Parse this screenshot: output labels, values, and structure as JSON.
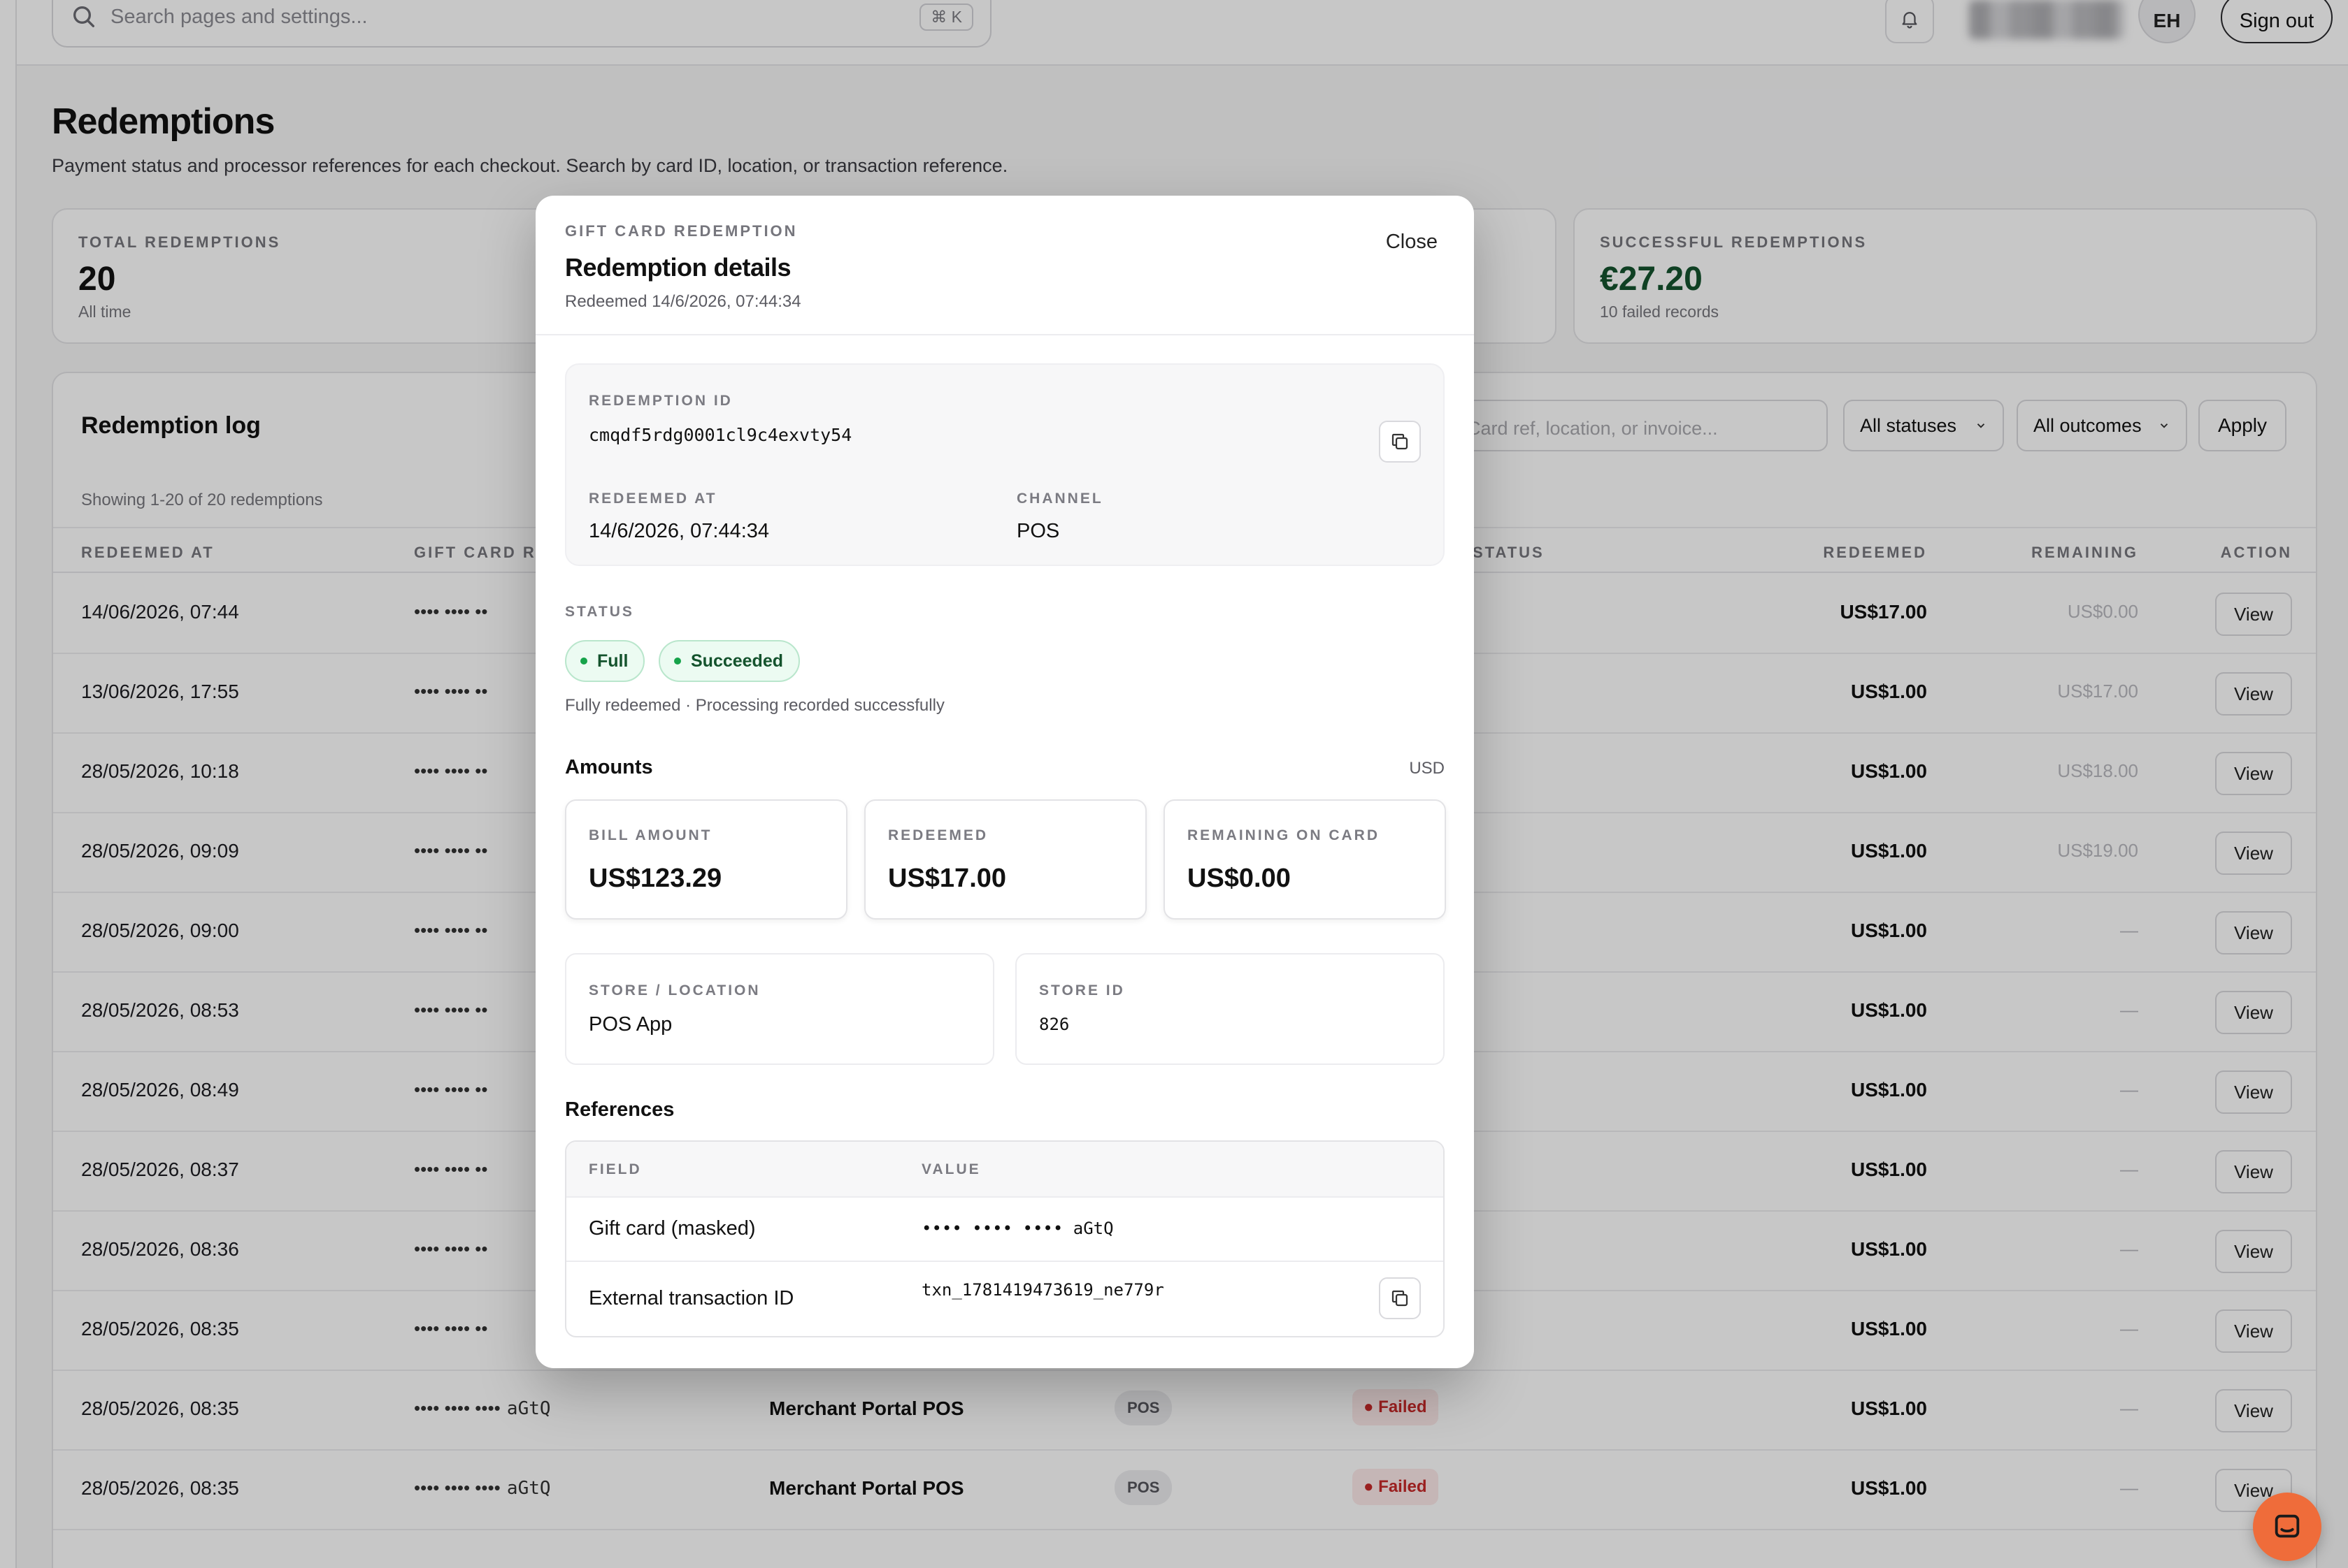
{
  "topbar": {
    "search_placeholder": "Search pages and settings...",
    "shortcut": "⌘ K",
    "avatar_initials": "EH",
    "sign_out": "Sign out"
  },
  "page": {
    "title": "Redemptions",
    "subtitle": "Payment status and processor references for each checkout. Search by card ID, location, or transaction reference."
  },
  "stats": {
    "total": {
      "label": "TOTAL REDEMPTIONS",
      "value": "20",
      "sub": "All time"
    },
    "successful": {
      "label": "SUCCESSFUL REDEMPTIONS",
      "value": "€27.20",
      "sub": "10 failed records"
    }
  },
  "log": {
    "title": "Redemption log",
    "filter_placeholder": "Card ref, location, or invoice...",
    "status_select": "All statuses",
    "outcome_select": "All outcomes",
    "apply": "Apply",
    "showing": "Showing 1-20 of 20 redemptions",
    "columns": {
      "redeemed_at": "REDEEMED AT",
      "gift_card": "GIFT CARD RE",
      "status": "STATUS",
      "redeemed": "REDEEMED",
      "remaining": "REMAINING",
      "action": "ACTION"
    },
    "view_label": "View",
    "rows": [
      {
        "date": "14/06/2026, 07:44",
        "card": "•••• •••• ••",
        "redeemed": "US$17.00",
        "remaining": "US$0.00"
      },
      {
        "date": "13/06/2026, 17:55",
        "card": "•••• •••• ••",
        "redeemed": "US$1.00",
        "remaining": "US$17.00"
      },
      {
        "date": "28/05/2026, 10:18",
        "card": "•••• •••• ••",
        "redeemed": "US$1.00",
        "remaining": "US$18.00"
      },
      {
        "date": "28/05/2026, 09:09",
        "card": "•••• •••• ••",
        "redeemed": "US$1.00",
        "remaining": "US$19.00"
      },
      {
        "date": "28/05/2026, 09:00",
        "card": "•••• •••• ••",
        "redeemed": "US$1.00",
        "remaining": "—"
      },
      {
        "date": "28/05/2026, 08:53",
        "card": "•••• •••• ••",
        "redeemed": "US$1.00",
        "remaining": "—"
      },
      {
        "date": "28/05/2026, 08:49",
        "card": "•••• •••• ••",
        "redeemed": "US$1.00",
        "remaining": "—"
      },
      {
        "date": "28/05/2026, 08:37",
        "card": "•••• •••• ••",
        "redeemed": "US$1.00",
        "remaining": "—"
      },
      {
        "date": "28/05/2026, 08:36",
        "card": "•••• •••• ••",
        "redeemed": "US$1.00",
        "remaining": "—"
      },
      {
        "date": "28/05/2026, 08:35",
        "card": "•••• •••• ••",
        "redeemed": "US$1.00",
        "remaining": "—"
      },
      {
        "date": "28/05/2026, 08:35",
        "card": "•••• •••• ••••",
        "card_suffix": "aGtQ",
        "merchant": "Merchant Portal POS",
        "channel": "POS",
        "status": "Failed",
        "redeemed": "US$1.00",
        "remaining": "—"
      },
      {
        "date": "28/05/2026, 08:35",
        "card": "•••• •••• ••••",
        "card_suffix": "aGtQ",
        "merchant": "Merchant Portal POS",
        "channel": "POS",
        "status": "Failed",
        "redeemed": "US$1.00",
        "remaining": "—"
      }
    ]
  },
  "modal": {
    "eyebrow": "GIFT CARD REDEMPTION",
    "title": "Redemption details",
    "subtitle": "Redeemed 14/6/2026, 07:44:34",
    "close": "Close",
    "redemption_id_label": "REDEMPTION ID",
    "redemption_id": "cmqdf5rdg0001cl9c4exvty54",
    "redeemed_at_label": "REDEEMED AT",
    "redeemed_at": "14/6/2026, 07:44:34",
    "channel_label": "CHANNEL",
    "channel": "POS",
    "status_label": "STATUS",
    "status_full": "Full",
    "status_succeeded": "Succeeded",
    "status_note": "Fully redeemed · Processing recorded successfully",
    "amounts_title": "Amounts",
    "currency": "USD",
    "bill_amount_label": "BILL AMOUNT",
    "bill_amount": "US$123.29",
    "redeemed_label": "REDEEMED",
    "redeemed": "US$17.00",
    "remaining_label": "REMAINING ON CARD",
    "remaining": "US$0.00",
    "store_location_label": "STORE / LOCATION",
    "store_location": "POS App",
    "store_id_label": "STORE ID",
    "store_id": "826",
    "references_title": "References",
    "ref_field_header": "FIELD",
    "ref_value_header": "VALUE",
    "references": [
      {
        "field": "Gift card (masked)",
        "value": "•••• •••• •••• aGtQ"
      },
      {
        "field": "External transaction ID",
        "value": "txn_1781419473619_ne779r"
      }
    ]
  },
  "colors": {
    "accent_green": "#16a34a",
    "failed_red": "#c62828",
    "chat": "#ef6c3a"
  }
}
